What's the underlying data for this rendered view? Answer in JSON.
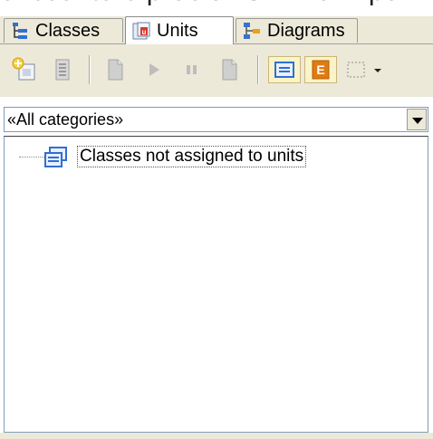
{
  "background_text": "encountere problems while impo",
  "tabs": [
    {
      "label": "Classes",
      "icon": "classes-tree-icon"
    },
    {
      "label": "Units",
      "icon": "unit-icon"
    },
    {
      "label": "Diagrams",
      "icon": "diagram-icon"
    }
  ],
  "active_tab": "Units",
  "category_select": {
    "value": "«All categories»"
  },
  "tree": {
    "items": [
      {
        "label": "Classes not assigned to units",
        "icon": "class-group-icon"
      }
    ]
  }
}
